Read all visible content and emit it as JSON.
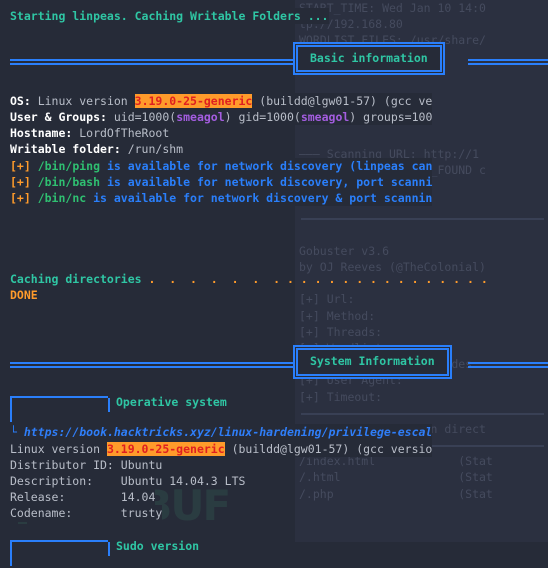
{
  "terminal": {
    "bg_color": "#262b38",
    "panel_bg_color": "#2b3040",
    "accent_blue": "#2a7ffb",
    "accent_teal": "#2fc6a4",
    "accent_orange": "#ff9b2b",
    "highlight_fg": "#e02020",
    "purple": "#a45de0",
    "green": "#2fbf71"
  },
  "intro": {
    "line": "Starting linpeas. Caching Writable Folders ..."
  },
  "sections": {
    "basic_information": "Basic information",
    "system_information": "System Information"
  },
  "subsections": {
    "operative_system": "Operative system",
    "sudo_version": "Sudo version"
  },
  "basic": {
    "os_label": "OS:",
    "os_prefix": " Linux version ",
    "os_kernel": "3.19.0-25-generic",
    "os_suffix": " (buildd@lgw01-57) (gcc ve",
    "user_label": "User & Groups:",
    "user_uid": " uid=1000(",
    "user_name1": "smeagol",
    "user_mid": ") gid=1000(",
    "user_name2": "smeagol",
    "user_tail": ") groups=100",
    "hostname_label": "Hostname:",
    "hostname_value": " LordOfTheRoot",
    "writable_label": "Writable folder:",
    "writable_value": " /run/shm",
    "tools": [
      {
        "marker": "[+]",
        "path": " /bin/ping",
        "text": " is available for network discovery (linpeas can"
      },
      {
        "marker": "[+]",
        "path": " /bin/bash",
        "text": " is available for network discovery, port scanni"
      },
      {
        "marker": "[+]",
        "path": " /bin/nc",
        "text": " is available for network discovery & port scannin"
      }
    ],
    "caching_label": "Caching directories",
    "caching_dots": " .  .  .  .  .  .  . . . . . . . . . . . . . . . .",
    "done": "DONE"
  },
  "system": {
    "hacktricks_url": "https://book.hacktricks.xyz/linux-hardening/privilege-escal",
    "kernel_prefix": "Linux version ",
    "kernel_value": "3.19.0-25-generic",
    "kernel_suffix": " (buildd@lgw01-57) (gcc versio",
    "rows": [
      {
        "label": "Distributor ID:",
        "value": "Ubuntu",
        "pad": " "
      },
      {
        "label": "Description:",
        "value": "Ubuntu 14.04.3 LTS",
        "pad": "    "
      },
      {
        "label": "Release:",
        "value": "14.04",
        "pad": "        "
      },
      {
        "label": "Codename:",
        "value": "trusty",
        "pad": "       "
      }
    ]
  },
  "background_pane": {
    "lines": [
      "START_TIME: Wed Jan 10 14:0",
      "tp://192.168.80",
      "WORDLIST_FILES: /usr/share/",
      "",
      "",
      "",
      "",
      "",
      "",
      "——— Scanning URL: http://1",
      "^C* Calculating NOT_FOUND c",
      "",
      "",
      "",
      "",
      "Gobuster v3.6",
      "by OJ Reeves (@TheColonial)",
      "",
      "[+] Url:",
      "[+] Method:",
      "[+] Threads:",
      "[+] Wordlist:",
      "[+] Negative Status codes:",
      "[+] User Agent:",
      "[+] Timeout:",
      "",
      "Starting gobuster in direct",
      "",
      "/index.html            (Stat",
      "/.html                 (Stat",
      "/.php                  (Stat"
    ]
  },
  "watermark": {
    "text": "FREEBUF"
  }
}
